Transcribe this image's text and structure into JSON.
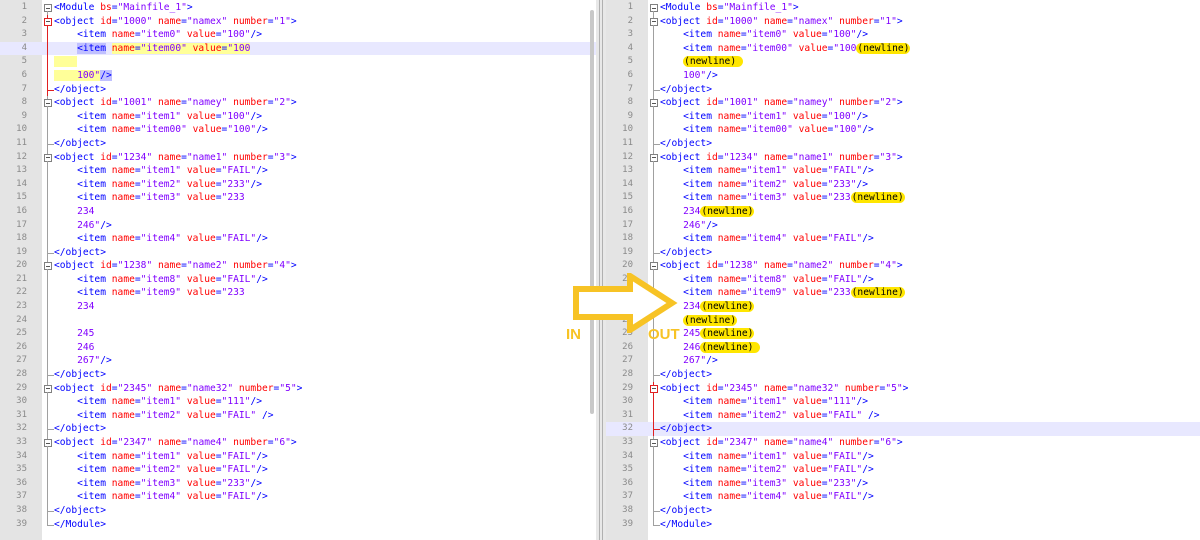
{
  "left": {
    "lines": [
      {
        "n": "1",
        "html": "<span class='tag'>&lt;Module </span><span class='attr'>bs</span><span class='tag'>=</span><span class='val'>\"Mainfile_1\"</span><span class='tag'>&gt;</span>"
      },
      {
        "n": "2",
        "html": "<span class='tag'>&lt;object </span><span class='attr'>id</span><span class='tag'>=</span><span class='val'>\"1000\" </span><span class='attr'>name</span><span class='tag'>=</span><span class='val'>\"namex\" </span><span class='attr'>number</span><span class='tag'>=</span><span class='val'>\"1\"</span><span class='tag'>&gt;</span>"
      },
      {
        "n": "3",
        "html": "    <span class='tag'>&lt;item </span><span class='attr'>name</span><span class='tag'>=</span><span class='val'>\"item0\" </span><span class='attr'>value</span><span class='tag'>=</span><span class='val'>\"100\"</span><span class='tag'>/&gt;</span>"
      },
      {
        "n": "4",
        "hl": true,
        "html": "    <span class='tag sel'>&lt;item</span> <span class='attr yhl'>name</span><span class='tag yhl'>=</span><span class='val yhl'>\"item00\" </span><span class='attr yhl'>value</span><span class='tag yhl'>=</span><span class='val yhl'>\"100</span>"
      },
      {
        "n": "5",
        "html": "<span class='yhl'>    </span>"
      },
      {
        "n": "6",
        "html": "<span class='yhl'>    </span><span class='val yhl'>100\"</span><span class='tag sel'>/&gt;</span>"
      },
      {
        "n": "7",
        "html": "<span class='tag'>&lt;/object&gt;</span>"
      },
      {
        "n": "8",
        "html": "<span class='tag'>&lt;object </span><span class='attr'>id</span><span class='tag'>=</span><span class='val'>\"1001\" </span><span class='attr'>name</span><span class='tag'>=</span><span class='val'>\"namey\" </span><span class='attr'>number</span><span class='tag'>=</span><span class='val'>\"2\"</span><span class='tag'>&gt;</span>"
      },
      {
        "n": "9",
        "html": "    <span class='tag'>&lt;item </span><span class='attr'>name</span><span class='tag'>=</span><span class='val'>\"item1\" </span><span class='attr'>value</span><span class='tag'>=</span><span class='val'>\"100\"</span><span class='tag'>/&gt;</span>"
      },
      {
        "n": "10",
        "html": "    <span class='tag'>&lt;item </span><span class='attr'>name</span><span class='tag'>=</span><span class='val'>\"item00\" </span><span class='attr'>value</span><span class='tag'>=</span><span class='val'>\"100\"</span><span class='tag'>/&gt;</span>"
      },
      {
        "n": "11",
        "html": "<span class='tag'>&lt;/object&gt;</span>"
      },
      {
        "n": "12",
        "html": "<span class='tag'>&lt;object </span><span class='attr'>id</span><span class='tag'>=</span><span class='val'>\"1234\" </span><span class='attr'>name</span><span class='tag'>=</span><span class='val'>\"name1\" </span><span class='attr'>number</span><span class='tag'>=</span><span class='val'>\"3\"</span><span class='tag'>&gt;</span>"
      },
      {
        "n": "13",
        "html": "    <span class='tag'>&lt;item </span><span class='attr'>name</span><span class='tag'>=</span><span class='val'>\"item1\" </span><span class='attr'>value</span><span class='tag'>=</span><span class='val'>\"FAIL\"</span><span class='tag'>/&gt;</span>"
      },
      {
        "n": "14",
        "html": "    <span class='tag'>&lt;item </span><span class='attr'>name</span><span class='tag'>=</span><span class='val'>\"item2\" </span><span class='attr'>value</span><span class='tag'>=</span><span class='val'>\"233\"</span><span class='tag'>/&gt;</span>"
      },
      {
        "n": "15",
        "html": "    <span class='tag'>&lt;item </span><span class='attr'>name</span><span class='tag'>=</span><span class='val'>\"item3\" </span><span class='attr'>value</span><span class='tag'>=</span><span class='val'>\"233</span>"
      },
      {
        "n": "16",
        "html": "    <span class='val'>234</span>"
      },
      {
        "n": "17",
        "html": "    <span class='val'>246\"</span><span class='tag'>/&gt;</span>"
      },
      {
        "n": "18",
        "html": "    <span class='tag'>&lt;item </span><span class='attr'>name</span><span class='tag'>=</span><span class='val'>\"item4\" </span><span class='attr'>value</span><span class='tag'>=</span><span class='val'>\"FAIL\"</span><span class='tag'>/&gt;</span>"
      },
      {
        "n": "19",
        "html": "<span class='tag'>&lt;/object&gt;</span>"
      },
      {
        "n": "20",
        "html": "<span class='tag'>&lt;object </span><span class='attr'>id</span><span class='tag'>=</span><span class='val'>\"1238\" </span><span class='attr'>name</span><span class='tag'>=</span><span class='val'>\"name2\" </span><span class='attr'>number</span><span class='tag'>=</span><span class='val'>\"4\"</span><span class='tag'>&gt;</span>"
      },
      {
        "n": "21",
        "html": "    <span class='tag'>&lt;item </span><span class='attr'>name</span><span class='tag'>=</span><span class='val'>\"item8\" </span><span class='attr'>value</span><span class='tag'>=</span><span class='val'>\"FAIL\"</span><span class='tag'>/&gt;</span>"
      },
      {
        "n": "22",
        "html": "    <span class='tag'>&lt;item </span><span class='attr'>name</span><span class='tag'>=</span><span class='val'>\"item9\" </span><span class='attr'>value</span><span class='tag'>=</span><span class='val'>\"233</span>"
      },
      {
        "n": "23",
        "html": "    <span class='val'>234</span>"
      },
      {
        "n": "24",
        "html": ""
      },
      {
        "n": "25",
        "html": "    <span class='val'>245</span>"
      },
      {
        "n": "26",
        "html": "    <span class='val'>246</span>"
      },
      {
        "n": "27",
        "html": "    <span class='val'>267\"</span><span class='tag'>/&gt;</span>"
      },
      {
        "n": "28",
        "html": "<span class='tag'>&lt;/object&gt;</span>"
      },
      {
        "n": "29",
        "html": "<span class='tag'>&lt;object </span><span class='attr'>id</span><span class='tag'>=</span><span class='val'>\"2345\" </span><span class='attr'>name</span><span class='tag'>=</span><span class='val'>\"name32\" </span><span class='attr'>number</span><span class='tag'>=</span><span class='val'>\"5\"</span><span class='tag'>&gt;</span>"
      },
      {
        "n": "30",
        "html": "    <span class='tag'>&lt;item </span><span class='attr'>name</span><span class='tag'>=</span><span class='val'>\"item1\" </span><span class='attr'>value</span><span class='tag'>=</span><span class='val'>\"111\"</span><span class='tag'>/&gt;</span>"
      },
      {
        "n": "31",
        "html": "    <span class='tag'>&lt;item </span><span class='attr'>name</span><span class='tag'>=</span><span class='val'>\"item2\" </span><span class='attr'>value</span><span class='tag'>=</span><span class='val'>\"FAIL\" </span><span class='tag'>/&gt;</span>"
      },
      {
        "n": "32",
        "html": "<span class='tag'>&lt;/object&gt;</span>"
      },
      {
        "n": "33",
        "html": "<span class='tag'>&lt;object </span><span class='attr'>id</span><span class='tag'>=</span><span class='val'>\"2347\" </span><span class='attr'>name</span><span class='tag'>=</span><span class='val'>\"name4\" </span><span class='attr'>number</span><span class='tag'>=</span><span class='val'>\"6\"</span><span class='tag'>&gt;</span>"
      },
      {
        "n": "34",
        "html": "    <span class='tag'>&lt;item </span><span class='attr'>name</span><span class='tag'>=</span><span class='val'>\"item1\" </span><span class='attr'>value</span><span class='tag'>=</span><span class='val'>\"FAIL\"</span><span class='tag'>/&gt;</span>"
      },
      {
        "n": "35",
        "html": "    <span class='tag'>&lt;item </span><span class='attr'>name</span><span class='tag'>=</span><span class='val'>\"item2\" </span><span class='attr'>value</span><span class='tag'>=</span><span class='val'>\"FAIL\"</span><span class='tag'>/&gt;</span>"
      },
      {
        "n": "36",
        "html": "    <span class='tag'>&lt;item </span><span class='attr'>name</span><span class='tag'>=</span><span class='val'>\"item3\" </span><span class='attr'>value</span><span class='tag'>=</span><span class='val'>\"233\"</span><span class='tag'>/&gt;</span>"
      },
      {
        "n": "37",
        "html": "    <span class='tag'>&lt;item </span><span class='attr'>name</span><span class='tag'>=</span><span class='val'>\"item4\" </span><span class='attr'>value</span><span class='tag'>=</span><span class='val'>\"FAIL\"</span><span class='tag'>/&gt;</span>"
      },
      {
        "n": "38",
        "html": "<span class='tag'>&lt;/object&gt;</span>"
      },
      {
        "n": "39",
        "html": "<span class='tag'>&lt;/Module&gt;</span>"
      }
    ]
  },
  "right": {
    "lines": [
      {
        "n": "1",
        "html": "<span class='tag'>&lt;Module </span><span class='attr'>bs</span><span class='tag'>=</span><span class='val'>\"Mainfile_1\"</span><span class='tag'>&gt;</span>"
      },
      {
        "n": "2",
        "html": "<span class='tag'>&lt;object </span><span class='attr'>id</span><span class='tag'>=</span><span class='val'>\"1000\" </span><span class='attr'>name</span><span class='tag'>=</span><span class='val'>\"namex\" </span><span class='attr'>number</span><span class='tag'>=</span><span class='val'>\"1\"</span><span class='tag'>&gt;</span>"
      },
      {
        "n": "3",
        "html": "    <span class='tag'>&lt;item </span><span class='attr'>name</span><span class='tag'>=</span><span class='val'>\"item0\" </span><span class='attr'>value</span><span class='tag'>=</span><span class='val'>\"100\"</span><span class='tag'>/&gt;</span>"
      },
      {
        "n": "4",
        "html": "    <span class='tag'>&lt;item </span><span class='attr'>name</span><span class='tag'>=</span><span class='val'>\"item00\" </span><span class='attr'>value</span><span class='tag'>=</span><span class='val'>\"100</span><span class='nl'>(newline)</span>"
      },
      {
        "n": "5",
        "html": "    <span class='nl'>(newline) </span>"
      },
      {
        "n": "6",
        "html": "    <span class='val'>100\"</span><span class='tag'>/&gt;</span>"
      },
      {
        "n": "7",
        "html": "<span class='tag'>&lt;/object&gt;</span>"
      },
      {
        "n": "8",
        "html": "<span class='tag'>&lt;object </span><span class='attr'>id</span><span class='tag'>=</span><span class='val'>\"1001\" </span><span class='attr'>name</span><span class='tag'>=</span><span class='val'>\"namey\" </span><span class='attr'>number</span><span class='tag'>=</span><span class='val'>\"2\"</span><span class='tag'>&gt;</span>"
      },
      {
        "n": "9",
        "html": "    <span class='tag'>&lt;item </span><span class='attr'>name</span><span class='tag'>=</span><span class='val'>\"item1\" </span><span class='attr'>value</span><span class='tag'>=</span><span class='val'>\"100\"</span><span class='tag'>/&gt;</span>"
      },
      {
        "n": "10",
        "html": "    <span class='tag'>&lt;item </span><span class='attr'>name</span><span class='tag'>=</span><span class='val'>\"item00\" </span><span class='attr'>value</span><span class='tag'>=</span><span class='val'>\"100\"</span><span class='tag'>/&gt;</span>"
      },
      {
        "n": "11",
        "html": "<span class='tag'>&lt;/object&gt;</span>"
      },
      {
        "n": "12",
        "html": "<span class='tag'>&lt;object </span><span class='attr'>id</span><span class='tag'>=</span><span class='val'>\"1234\" </span><span class='attr'>name</span><span class='tag'>=</span><span class='val'>\"name1\" </span><span class='attr'>number</span><span class='tag'>=</span><span class='val'>\"3\"</span><span class='tag'>&gt;</span>"
      },
      {
        "n": "13",
        "html": "    <span class='tag'>&lt;item </span><span class='attr'>name</span><span class='tag'>=</span><span class='val'>\"item1\" </span><span class='attr'>value</span><span class='tag'>=</span><span class='val'>\"FAIL\"</span><span class='tag'>/&gt;</span>"
      },
      {
        "n": "14",
        "html": "    <span class='tag'>&lt;item </span><span class='attr'>name</span><span class='tag'>=</span><span class='val'>\"item2\" </span><span class='attr'>value</span><span class='tag'>=</span><span class='val'>\"233\"</span><span class='tag'>/&gt;</span>"
      },
      {
        "n": "15",
        "html": "    <span class='tag'>&lt;item </span><span class='attr'>name</span><span class='tag'>=</span><span class='val'>\"item3\" </span><span class='attr'>value</span><span class='tag'>=</span><span class='val'>\"233</span><span class='nl'>(newline)</span>"
      },
      {
        "n": "16",
        "html": "    <span class='val'>234</span><span class='nl'>(newline)</span>"
      },
      {
        "n": "17",
        "html": "    <span class='val'>246\"</span><span class='tag'>/&gt;</span>"
      },
      {
        "n": "18",
        "html": "    <span class='tag'>&lt;item </span><span class='attr'>name</span><span class='tag'>=</span><span class='val'>\"item4\" </span><span class='attr'>value</span><span class='tag'>=</span><span class='val'>\"FAIL\"</span><span class='tag'>/&gt;</span>"
      },
      {
        "n": "19",
        "html": "<span class='tag'>&lt;/object&gt;</span>"
      },
      {
        "n": "20",
        "html": "<span class='tag'>&lt;object </span><span class='attr'>id</span><span class='tag'>=</span><span class='val'>\"1238\" </span><span class='attr'>name</span><span class='tag'>=</span><span class='val'>\"name2\" </span><span class='attr'>number</span><span class='tag'>=</span><span class='val'>\"4\"</span><span class='tag'>&gt;</span>"
      },
      {
        "n": "21",
        "html": "    <span class='tag'>&lt;item </span><span class='attr'>name</span><span class='tag'>=</span><span class='val'>\"item8\" </span><span class='attr'>value</span><span class='tag'>=</span><span class='val'>\"FAIL\"</span><span class='tag'>/&gt;</span>"
      },
      {
        "n": "22",
        "html": "    <span class='tag'>&lt;item </span><span class='attr'>name</span><span class='tag'>=</span><span class='val'>\"item9\" </span><span class='attr'>value</span><span class='tag'>=</span><span class='val'>\"233</span><span class='nl'>(newline)</span>"
      },
      {
        "n": "23",
        "html": "    <span class='val'>234</span><span class='nl'>(newline)</span>"
      },
      {
        "n": "24",
        "html": "    <span class='nl'>(newline)</span>"
      },
      {
        "n": "25",
        "html": "    <span class='val'>245</span><span class='nl'>(newline)</span>"
      },
      {
        "n": "26",
        "html": "    <span class='val'>246</span><span class='nl'>(newline) </span>"
      },
      {
        "n": "27",
        "html": "    <span class='val'>267\"</span><span class='tag'>/&gt;</span>"
      },
      {
        "n": "28",
        "html": "<span class='tag'>&lt;/object&gt;</span>"
      },
      {
        "n": "29",
        "html": "<span class='tag'>&lt;object </span><span class='attr'>id</span><span class='tag'>=</span><span class='val'>\"2345\" </span><span class='attr'>name</span><span class='tag'>=</span><span class='val'>\"name32\" </span><span class='attr'>number</span><span class='tag'>=</span><span class='val'>\"5\"</span><span class='tag'>&gt;</span>"
      },
      {
        "n": "30",
        "html": "    <span class='tag'>&lt;item </span><span class='attr'>name</span><span class='tag'>=</span><span class='val'>\"item1\" </span><span class='attr'>value</span><span class='tag'>=</span><span class='val'>\"111\"</span><span class='tag'>/&gt;</span>"
      },
      {
        "n": "31",
        "html": "    <span class='tag'>&lt;item </span><span class='attr'>name</span><span class='tag'>=</span><span class='val'>\"item2\" </span><span class='attr'>value</span><span class='tag'>=</span><span class='val'>\"FAIL\" </span><span class='tag'>/&gt;</span>"
      },
      {
        "n": "32",
        "hl": true,
        "html": "<span class='tag'>&lt;/object&gt;</span>"
      },
      {
        "n": "33",
        "html": "<span class='tag'>&lt;object </span><span class='attr'>id</span><span class='tag'>=</span><span class='val'>\"2347\" </span><span class='attr'>name</span><span class='tag'>=</span><span class='val'>\"name4\" </span><span class='attr'>number</span><span class='tag'>=</span><span class='val'>\"6\"</span><span class='tag'>&gt;</span>"
      },
      {
        "n": "34",
        "html": "    <span class='tag'>&lt;item </span><span class='attr'>name</span><span class='tag'>=</span><span class='val'>\"item1\" </span><span class='attr'>value</span><span class='tag'>=</span><span class='val'>\"FAIL\"</span><span class='tag'>/&gt;</span>"
      },
      {
        "n": "35",
        "html": "    <span class='tag'>&lt;item </span><span class='attr'>name</span><span class='tag'>=</span><span class='val'>\"item2\" </span><span class='attr'>value</span><span class='tag'>=</span><span class='val'>\"FAIL\"</span><span class='tag'>/&gt;</span>"
      },
      {
        "n": "36",
        "html": "    <span class='tag'>&lt;item </span><span class='attr'>name</span><span class='tag'>=</span><span class='val'>\"item3\" </span><span class='attr'>value</span><span class='tag'>=</span><span class='val'>\"233\"</span><span class='tag'>/&gt;</span>"
      },
      {
        "n": "37",
        "html": "    <span class='tag'>&lt;item </span><span class='attr'>name</span><span class='tag'>=</span><span class='val'>\"item4\" </span><span class='attr'>value</span><span class='tag'>=</span><span class='val'>\"FAIL\"</span><span class='tag'>/&gt;</span>"
      },
      {
        "n": "38",
        "html": "<span class='tag'>&lt;/object&gt;</span>"
      },
      {
        "n": "39",
        "html": "<span class='tag'>&lt;/Module&gt;</span>"
      }
    ]
  },
  "annotation": {
    "in_label": "IN",
    "out_label": "OUT",
    "arrow_icon": "right-arrow-icon",
    "arrow_color": "#f7c325"
  },
  "colors": {
    "tag": "#0000ff",
    "attribute": "#ff0000",
    "value": "#8000ff",
    "newline_highlight": "#ffe600"
  }
}
